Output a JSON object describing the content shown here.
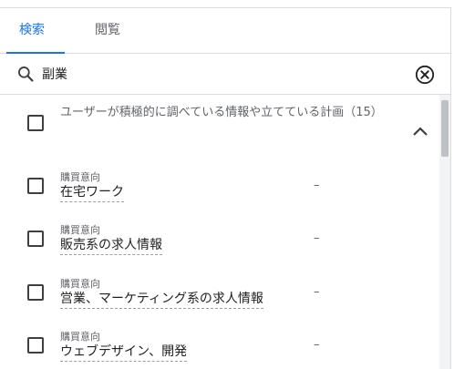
{
  "tabs": [
    {
      "label": "検索",
      "active": true
    },
    {
      "label": "閲覧",
      "active": false
    }
  ],
  "search": {
    "value": "副業",
    "icon": "search-icon",
    "clear_icon": "clear-circle-icon"
  },
  "group": {
    "title": "ユーザーが積極的に調べている情報や立てている計画（15）",
    "expanded": true,
    "checked": false
  },
  "items": [
    {
      "category": "購買意向",
      "name": "在宅ワーク",
      "value": "–",
      "checked": false
    },
    {
      "category": "購買意向",
      "name": "販売系の求人情報",
      "value": "–",
      "checked": false
    },
    {
      "category": "購買意向",
      "name": "営業、マーケティング系の求人情報",
      "value": "–",
      "checked": false
    },
    {
      "category": "購買意向",
      "name": "ウェブデザイン、開発",
      "value": "–",
      "checked": false
    }
  ],
  "colors": {
    "accent": "#1a73e8",
    "text": "#3c4043",
    "divider": "#dadce0"
  }
}
